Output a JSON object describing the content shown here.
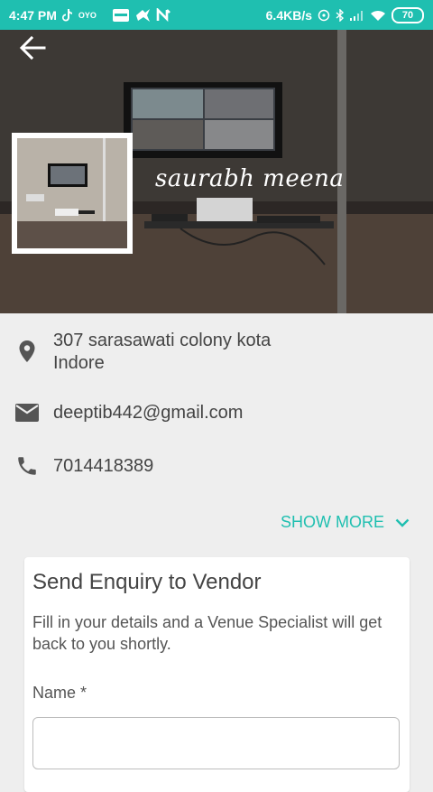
{
  "status_bar": {
    "time": "4:47 PM",
    "network_speed": "6.4KB/s",
    "battery": "70",
    "icons": [
      "tiktok-icon",
      "oyo-icon",
      "app-icon",
      "bird-icon",
      "n-icon",
      "hotspot-icon",
      "bluetooth-icon",
      "signal-icon",
      "wifi-icon"
    ]
  },
  "header": {
    "back_icon": "back-arrow-icon",
    "vendor_name": "saurabh meena"
  },
  "info": {
    "address_line1": "307 sarasawati colony kota",
    "address_line2": "Indore",
    "email": "deeptib442@gmail.com",
    "phone": "7014418389",
    "show_more": "SHOW MORE"
  },
  "enquiry": {
    "title": "Send Enquiry to Vendor",
    "description": "Fill in your details and a Venue Specialist will get back to you shortly.",
    "name_label": "Name *",
    "name_value": ""
  },
  "colors": {
    "accent": "#1fbfb0",
    "background": "#eeeeee",
    "icon": "#555555"
  }
}
